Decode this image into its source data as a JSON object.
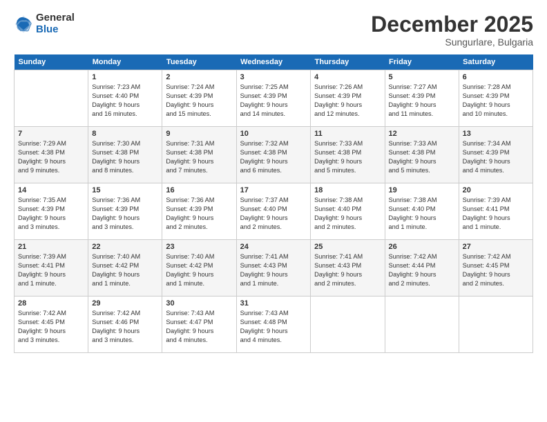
{
  "header": {
    "logo_general": "General",
    "logo_blue": "Blue",
    "month_title": "December 2025",
    "location": "Sungurlare, Bulgaria"
  },
  "weekdays": [
    "Sunday",
    "Monday",
    "Tuesday",
    "Wednesday",
    "Thursday",
    "Friday",
    "Saturday"
  ],
  "weeks": [
    [
      {
        "day": "",
        "info": ""
      },
      {
        "day": "1",
        "info": "Sunrise: 7:23 AM\nSunset: 4:40 PM\nDaylight: 9 hours\nand 16 minutes."
      },
      {
        "day": "2",
        "info": "Sunrise: 7:24 AM\nSunset: 4:39 PM\nDaylight: 9 hours\nand 15 minutes."
      },
      {
        "day": "3",
        "info": "Sunrise: 7:25 AM\nSunset: 4:39 PM\nDaylight: 9 hours\nand 14 minutes."
      },
      {
        "day": "4",
        "info": "Sunrise: 7:26 AM\nSunset: 4:39 PM\nDaylight: 9 hours\nand 12 minutes."
      },
      {
        "day": "5",
        "info": "Sunrise: 7:27 AM\nSunset: 4:39 PM\nDaylight: 9 hours\nand 11 minutes."
      },
      {
        "day": "6",
        "info": "Sunrise: 7:28 AM\nSunset: 4:39 PM\nDaylight: 9 hours\nand 10 minutes."
      }
    ],
    [
      {
        "day": "7",
        "info": "Sunrise: 7:29 AM\nSunset: 4:38 PM\nDaylight: 9 hours\nand 9 minutes."
      },
      {
        "day": "8",
        "info": "Sunrise: 7:30 AM\nSunset: 4:38 PM\nDaylight: 9 hours\nand 8 minutes."
      },
      {
        "day": "9",
        "info": "Sunrise: 7:31 AM\nSunset: 4:38 PM\nDaylight: 9 hours\nand 7 minutes."
      },
      {
        "day": "10",
        "info": "Sunrise: 7:32 AM\nSunset: 4:38 PM\nDaylight: 9 hours\nand 6 minutes."
      },
      {
        "day": "11",
        "info": "Sunrise: 7:33 AM\nSunset: 4:38 PM\nDaylight: 9 hours\nand 5 minutes."
      },
      {
        "day": "12",
        "info": "Sunrise: 7:33 AM\nSunset: 4:38 PM\nDaylight: 9 hours\nand 5 minutes."
      },
      {
        "day": "13",
        "info": "Sunrise: 7:34 AM\nSunset: 4:39 PM\nDaylight: 9 hours\nand 4 minutes."
      }
    ],
    [
      {
        "day": "14",
        "info": "Sunrise: 7:35 AM\nSunset: 4:39 PM\nDaylight: 9 hours\nand 3 minutes."
      },
      {
        "day": "15",
        "info": "Sunrise: 7:36 AM\nSunset: 4:39 PM\nDaylight: 9 hours\nand 3 minutes."
      },
      {
        "day": "16",
        "info": "Sunrise: 7:36 AM\nSunset: 4:39 PM\nDaylight: 9 hours\nand 2 minutes."
      },
      {
        "day": "17",
        "info": "Sunrise: 7:37 AM\nSunset: 4:40 PM\nDaylight: 9 hours\nand 2 minutes."
      },
      {
        "day": "18",
        "info": "Sunrise: 7:38 AM\nSunset: 4:40 PM\nDaylight: 9 hours\nand 2 minutes."
      },
      {
        "day": "19",
        "info": "Sunrise: 7:38 AM\nSunset: 4:40 PM\nDaylight: 9 hours\nand 1 minute."
      },
      {
        "day": "20",
        "info": "Sunrise: 7:39 AM\nSunset: 4:41 PM\nDaylight: 9 hours\nand 1 minute."
      }
    ],
    [
      {
        "day": "21",
        "info": "Sunrise: 7:39 AM\nSunset: 4:41 PM\nDaylight: 9 hours\nand 1 minute."
      },
      {
        "day": "22",
        "info": "Sunrise: 7:40 AM\nSunset: 4:42 PM\nDaylight: 9 hours\nand 1 minute."
      },
      {
        "day": "23",
        "info": "Sunrise: 7:40 AM\nSunset: 4:42 PM\nDaylight: 9 hours\nand 1 minute."
      },
      {
        "day": "24",
        "info": "Sunrise: 7:41 AM\nSunset: 4:43 PM\nDaylight: 9 hours\nand 1 minute."
      },
      {
        "day": "25",
        "info": "Sunrise: 7:41 AM\nSunset: 4:43 PM\nDaylight: 9 hours\nand 2 minutes."
      },
      {
        "day": "26",
        "info": "Sunrise: 7:42 AM\nSunset: 4:44 PM\nDaylight: 9 hours\nand 2 minutes."
      },
      {
        "day": "27",
        "info": "Sunrise: 7:42 AM\nSunset: 4:45 PM\nDaylight: 9 hours\nand 2 minutes."
      }
    ],
    [
      {
        "day": "28",
        "info": "Sunrise: 7:42 AM\nSunset: 4:45 PM\nDaylight: 9 hours\nand 3 minutes."
      },
      {
        "day": "29",
        "info": "Sunrise: 7:42 AM\nSunset: 4:46 PM\nDaylight: 9 hours\nand 3 minutes."
      },
      {
        "day": "30",
        "info": "Sunrise: 7:43 AM\nSunset: 4:47 PM\nDaylight: 9 hours\nand 4 minutes."
      },
      {
        "day": "31",
        "info": "Sunrise: 7:43 AM\nSunset: 4:48 PM\nDaylight: 9 hours\nand 4 minutes."
      },
      {
        "day": "",
        "info": ""
      },
      {
        "day": "",
        "info": ""
      },
      {
        "day": "",
        "info": ""
      }
    ]
  ]
}
